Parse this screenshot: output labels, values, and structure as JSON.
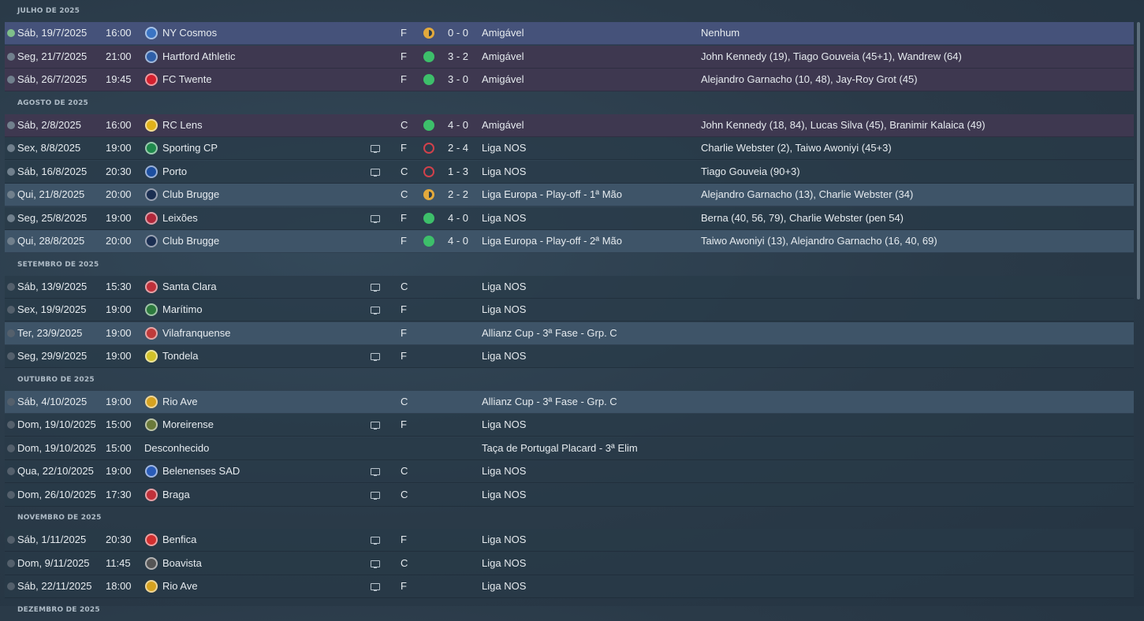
{
  "colors": {
    "win": "#3dbf6a",
    "draw": "#e3a93c",
    "loss": "#d1414b",
    "friendly_row": "#3e3850",
    "highlight_row": "#3e5468"
  },
  "groups": [
    {
      "month": "JULHO DE 2025",
      "matches": [
        {
          "type": "nextgame",
          "date": "Sáb, 19/7/2025",
          "time": "16:00",
          "badge": "#3a74c4",
          "team": "NY Cosmos",
          "tv": false,
          "venue": "F",
          "result": "draw",
          "score": "0 - 0",
          "competition": "Amigável",
          "scorers": "Nenhum"
        },
        {
          "type": "friendly",
          "date": "Seg, 21/7/2025",
          "time": "21:00",
          "badge": "#2f5fa8",
          "team": "Hartford Athletic",
          "tv": false,
          "venue": "F",
          "result": "win",
          "score": "3 - 2",
          "competition": "Amigável",
          "scorers": "John Kennedy (19), Tiago Gouveia (45+1), Wandrew (64)"
        },
        {
          "type": "friendly",
          "date": "Sáb, 26/7/2025",
          "time": "19:45",
          "badge": "#d4202e",
          "team": "FC Twente",
          "tv": false,
          "venue": "F",
          "result": "win",
          "score": "3 - 0",
          "competition": "Amigável",
          "scorers": "Alejandro Garnacho (10, 48), Jay-Roy Grot (45)"
        }
      ]
    },
    {
      "month": "AGOSTO DE 2025",
      "matches": [
        {
          "type": "friendly",
          "date": "Sáb, 2/8/2025",
          "time": "16:00",
          "badge": "#e0b21a",
          "team": "RC Lens",
          "tv": false,
          "venue": "C",
          "result": "win",
          "score": "4 - 0",
          "competition": "Amigável",
          "scorers": "John Kennedy (18, 84), Lucas Silva (45), Branimir Kalaica (49)"
        },
        {
          "type": "",
          "date": "Sex, 8/8/2025",
          "time": "19:00",
          "badge": "#1f8a4c",
          "team": "Sporting CP",
          "tv": true,
          "venue": "F",
          "result": "loss",
          "score": "2 - 4",
          "competition": "Liga NOS",
          "scorers": "Charlie Webster (2), Taiwo Awoniyi (45+3)"
        },
        {
          "type": "",
          "date": "Sáb, 16/8/2025",
          "time": "20:30",
          "badge": "#1d4fa0",
          "team": "Porto",
          "tv": true,
          "venue": "C",
          "result": "loss",
          "score": "1 - 3",
          "competition": "Liga NOS",
          "scorers": "Tiago Gouveia (90+3)"
        },
        {
          "type": "europe",
          "date": "Qui, 21/8/2025",
          "time": "20:00",
          "badge": "#1b2f52",
          "team": "Club Brugge",
          "tv": false,
          "venue": "C",
          "result": "draw",
          "score": "2 - 2",
          "competition": "Liga Europa - Play-off - 1ª Mão",
          "scorers": "Alejandro Garnacho (13), Charlie Webster (34)"
        },
        {
          "type": "",
          "date": "Seg, 25/8/2025",
          "time": "19:00",
          "badge": "#b0273a",
          "team": "Leixões",
          "tv": true,
          "venue": "F",
          "result": "win",
          "score": "4 - 0",
          "competition": "Liga NOS",
          "scorers": "Berna (40, 56, 79), Charlie Webster (pen 54)"
        },
        {
          "type": "europe",
          "date": "Qui, 28/8/2025",
          "time": "20:00",
          "badge": "#1b2f52",
          "team": "Club Brugge",
          "tv": false,
          "venue": "F",
          "result": "win",
          "score": "4 - 0",
          "competition": "Liga Europa - Play-off - 2ª Mão",
          "scorers": "Taiwo Awoniyi (13), Alejandro Garnacho (16, 40, 69)"
        }
      ]
    },
    {
      "month": "SETEMBRO DE 2025",
      "matches": [
        {
          "type": "",
          "date": "Sáb, 13/9/2025",
          "time": "15:30",
          "badge": "#c0303a",
          "team": "Santa Clara",
          "tv": true,
          "venue": "C",
          "result": "",
          "score": "",
          "competition": "Liga NOS",
          "scorers": ""
        },
        {
          "type": "",
          "date": "Sex, 19/9/2025",
          "time": "19:00",
          "badge": "#2d7a3e",
          "team": "Marítimo",
          "tv": true,
          "venue": "F",
          "result": "",
          "score": "",
          "competition": "Liga NOS",
          "scorers": ""
        },
        {
          "type": "cup",
          "date": "Ter, 23/9/2025",
          "time": "19:00",
          "badge": "#c03a3a",
          "team": "Vilafranquense",
          "tv": false,
          "venue": "F",
          "result": "",
          "score": "",
          "competition": "Allianz Cup - 3ª Fase - Grp. C",
          "scorers": ""
        },
        {
          "type": "",
          "date": "Seg, 29/9/2025",
          "time": "19:00",
          "badge": "#d2c22a",
          "team": "Tondela",
          "tv": true,
          "venue": "F",
          "result": "",
          "score": "",
          "competition": "Liga NOS",
          "scorers": ""
        }
      ]
    },
    {
      "month": "OUTUBRO DE 2025",
      "matches": [
        {
          "type": "cup",
          "date": "Sáb, 4/10/2025",
          "time": "19:00",
          "badge": "#d6a220",
          "team": "Rio Ave",
          "tv": false,
          "venue": "C",
          "result": "",
          "score": "",
          "competition": "Allianz Cup - 3ª Fase - Grp. C",
          "scorers": ""
        },
        {
          "type": "",
          "date": "Dom, 19/10/2025",
          "time": "15:00",
          "badge": "#6b7a3a",
          "team": "Moreirense",
          "tv": true,
          "venue": "F",
          "result": "",
          "score": "",
          "competition": "Liga NOS",
          "scorers": ""
        },
        {
          "type": "",
          "date": "Dom, 19/10/2025",
          "time": "15:00",
          "badge": "",
          "team": "Desconhecido",
          "tv": false,
          "venue": "",
          "result": "",
          "score": "",
          "competition": "Taça de Portugal Placard - 3ª Elim",
          "scorers": ""
        },
        {
          "type": "",
          "date": "Qua, 22/10/2025",
          "time": "19:00",
          "badge": "#2a5cb8",
          "team": "Belenenses SAD",
          "tv": true,
          "venue": "C",
          "result": "",
          "score": "",
          "competition": "Liga NOS",
          "scorers": ""
        },
        {
          "type": "",
          "date": "Dom, 26/10/2025",
          "time": "17:30",
          "badge": "#c0303a",
          "team": "Braga",
          "tv": true,
          "venue": "C",
          "result": "",
          "score": "",
          "competition": "Liga NOS",
          "scorers": ""
        }
      ]
    },
    {
      "month": "NOVEMBRO DE 2025",
      "matches": [
        {
          "type": "",
          "date": "Sáb, 1/11/2025",
          "time": "20:30",
          "badge": "#d22f2f",
          "team": "Benfica",
          "tv": true,
          "venue": "F",
          "result": "",
          "score": "",
          "competition": "Liga NOS",
          "scorers": ""
        },
        {
          "type": "",
          "date": "Dom, 9/11/2025",
          "time": "11:45",
          "badge": "#555555",
          "team": "Boavista",
          "tv": true,
          "venue": "C",
          "result": "",
          "score": "",
          "competition": "Liga NOS",
          "scorers": ""
        },
        {
          "type": "",
          "date": "Sáb, 22/11/2025",
          "time": "18:00",
          "badge": "#d6a220",
          "team": "Rio Ave",
          "tv": true,
          "venue": "F",
          "result": "",
          "score": "",
          "competition": "Liga NOS",
          "scorers": ""
        }
      ]
    },
    {
      "month": "DEZEMBRO DE 2025",
      "matches": []
    }
  ]
}
